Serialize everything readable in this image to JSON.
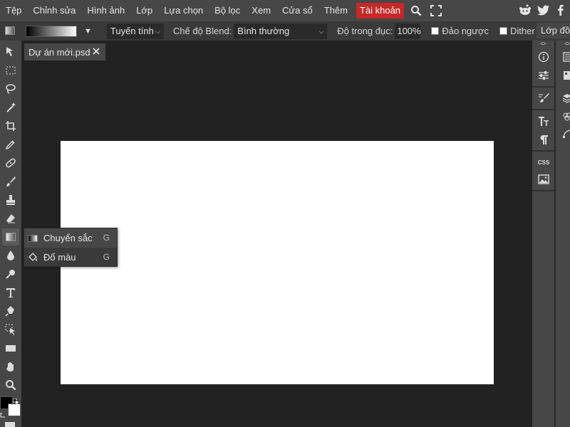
{
  "menubar": {
    "items": [
      "Tệp",
      "Chỉnh sửa",
      "Hình ảnh",
      "Lớp",
      "Lựa chọn",
      "Bộ lọc",
      "Xem",
      "Cửa sổ",
      "Thêm"
    ],
    "account_label": "Tài khoản",
    "accent_color": "#c62828",
    "icons": [
      "search-icon",
      "fullscreen-icon",
      "reddit-icon",
      "twitter-icon",
      "facebook-icon"
    ]
  },
  "options": {
    "gradient_type": "Tuyến tính",
    "blend_label": "Chế độ Blend:",
    "blend_value": "Bình thường",
    "opacity_label": "Độ trong đục:",
    "opacity_value": "100%",
    "reverse_label": "Đảo ngược",
    "dither_label": "Dither",
    "layer_button": "Lớp đồ"
  },
  "document": {
    "tab_title": "Dự án mới.psd",
    "canvas_color": "#ffffff"
  },
  "flyout": {
    "items": [
      {
        "label": "Chuyển sắc",
        "shortcut": "G",
        "icon": "gradient-icon"
      },
      {
        "label": "Đổ màu",
        "shortcut": "G",
        "icon": "paint-bucket-icon"
      }
    ]
  },
  "tools": [
    "move",
    "marquee",
    "lasso",
    "magic-wand",
    "crop",
    "eyedropper",
    "healing",
    "brush",
    "stamp",
    "eraser",
    "gradient",
    "blur",
    "dodge",
    "text",
    "pen",
    "path-select",
    "shape",
    "hand",
    "zoom"
  ],
  "panel": {
    "collapse_glyph": "<>",
    "css_label": "CSS"
  }
}
